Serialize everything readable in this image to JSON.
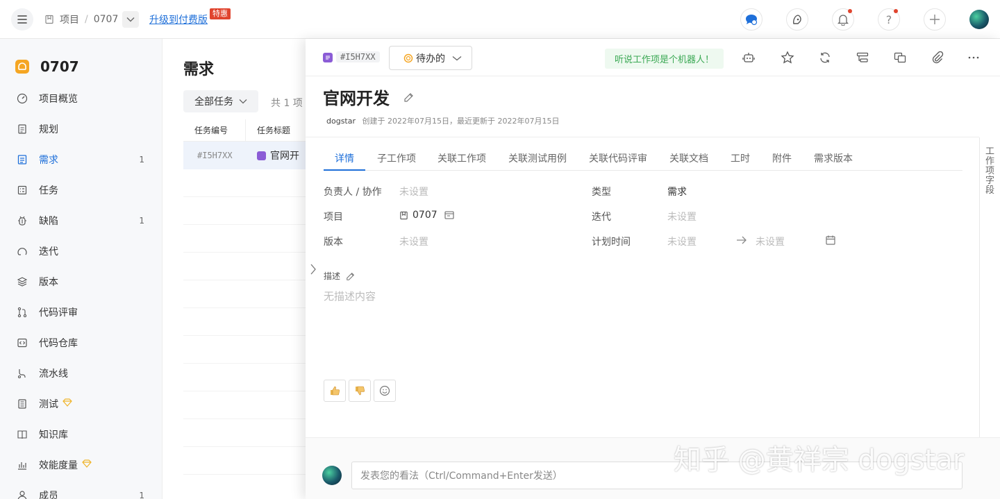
{
  "topbar": {
    "breadcrumb_project": "项目",
    "breadcrumb_sep": "/",
    "breadcrumb_current": "0707",
    "upgrade_link": "升级到付费版",
    "promo_badge": "特惠",
    "help_glyph": "?"
  },
  "sidebar": {
    "project_name": "0707",
    "items": [
      {
        "label": "项目概览",
        "count": ""
      },
      {
        "label": "规划",
        "count": ""
      },
      {
        "label": "需求",
        "count": "1"
      },
      {
        "label": "任务",
        "count": ""
      },
      {
        "label": "缺陷",
        "count": "1"
      },
      {
        "label": "迭代",
        "count": ""
      },
      {
        "label": "版本",
        "count": ""
      },
      {
        "label": "代码评审",
        "count": ""
      },
      {
        "label": "代码仓库",
        "count": ""
      },
      {
        "label": "流水线",
        "count": ""
      },
      {
        "label": "测试",
        "count": ""
      },
      {
        "label": "知识库",
        "count": ""
      },
      {
        "label": "效能度量",
        "count": ""
      },
      {
        "label": "成员",
        "count": "1"
      }
    ]
  },
  "main": {
    "title": "需求",
    "filter_label": "全部任务",
    "count_text": "共 1 项",
    "columns": [
      "任务编号",
      "任务标题"
    ],
    "rows": [
      {
        "id": "#I5H7XX",
        "title": "官网开"
      }
    ]
  },
  "drawer": {
    "item_id": "#I5H7XX",
    "status": "待办的",
    "robot_tip": "听说工作项是个机器人！",
    "title": "官网开发",
    "author": "dogstar",
    "meta": "创建于 2022年07月15日，最近更新于 2022年07月15日",
    "tabs": [
      "详情",
      "子工作项",
      "关联工作项",
      "关联测试用例",
      "关联代码评审",
      "关联文档",
      "工时",
      "附件",
      "需求版本"
    ],
    "fields": {
      "assignee_label": "负责人 / 协作",
      "assignee_value": "未设置",
      "type_label": "类型",
      "type_value": "需求",
      "project_label": "项目",
      "project_value": "0707",
      "iteration_label": "迭代",
      "iteration_value": "未设置",
      "version_label": "版本",
      "version_value": "未设置",
      "plan_label": "计划时间",
      "plan_start": "未设置",
      "plan_end": "未设置"
    },
    "description_label": "描述",
    "description_empty": "无描述内容",
    "side_panel_label": "工作项字段",
    "comment_placeholder": "发表您的看法（Ctrl/Command+Enter发送）"
  },
  "overlay_watermark": "知乎 @黄祥宗 dogstar",
  "colors": {
    "accent": "#1e6fd9",
    "promo": "#e0442e",
    "type_purple": "#8b5cd6",
    "robot_green": "#3aa853",
    "project_logo": "#f5a623"
  }
}
